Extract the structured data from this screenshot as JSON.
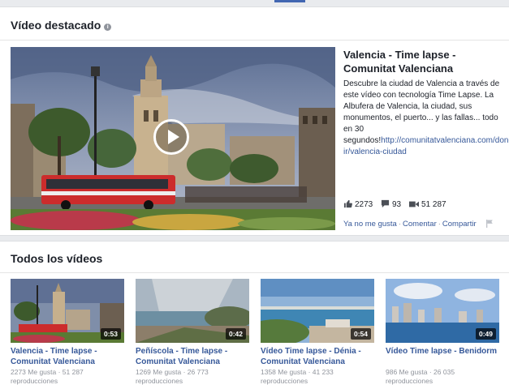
{
  "featured": {
    "section_title": "Vídeo destacado",
    "info_glyph": "i",
    "video": {
      "title": "Valencia - Time lapse - Comunitat Valenciana",
      "description": "Descubre la ciudad de Valencia a través de este vídeo con tecnología Time Lapse. La Albufera de Valencia, la ciudad, sus monumentos, el puerto... y las fallas... todo en 30 segundos!",
      "link": "http://comunitatvalenciana.com/donde-ir/valencia-ciudad",
      "likes": "2273",
      "comments": "93",
      "views": "51 287"
    },
    "actions": {
      "unlike": "Ya no me gusta",
      "comment": "Comentar",
      "share": "Compartir",
      "separator": "·"
    }
  },
  "all_videos": {
    "section_title": "Todos los vídeos",
    "items": [
      {
        "title": "Valencia - Time lapse - Comunitat Valenciana",
        "meta": "2273 Me gusta · 51 287 reproducciones",
        "duration": "0:53"
      },
      {
        "title": "Peñíscola - Time lapse - Comunitat Valenciana",
        "meta": "1269 Me gusta · 26 773 reproducciones",
        "duration": "0:42"
      },
      {
        "title": "Vídeo Time lapse - Dénia - Comunitat Valenciana",
        "meta": "1358 Me gusta · 41 233 reproducciones",
        "duration": "0:54"
      },
      {
        "title": "Vídeo Time lapse - Benidorm",
        "meta": "986 Me gusta · 26 035 reproducciones",
        "duration": "0:49"
      }
    ]
  },
  "colors": {
    "link": "#365899",
    "muted": "#90949c",
    "background": "#e9ebee",
    "accent": "#4267b2"
  },
  "icons": [
    "info-icon",
    "play-icon",
    "like-icon",
    "comment-icon",
    "video-views-icon",
    "flag-icon"
  ]
}
